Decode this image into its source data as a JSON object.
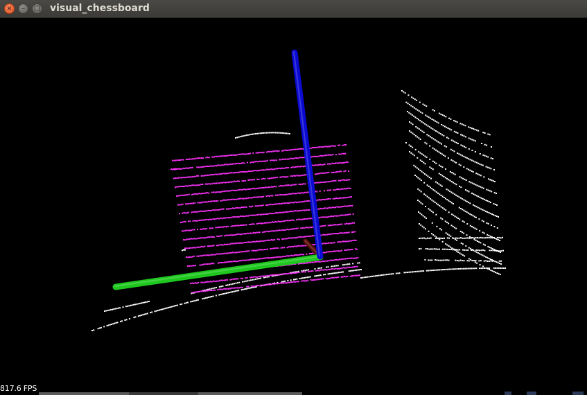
{
  "window": {
    "title": "visual_chessboard",
    "close_glyph": "×",
    "minimize_glyph": "–",
    "maximize_glyph": "□",
    "close_icon": "close-icon",
    "minimize_icon": "minimize-icon",
    "maximize_icon": "maximize-icon"
  },
  "viewport": {
    "fps_text": "817.6 FPS",
    "colors": {
      "background": "#000000",
      "chessboard_points": "#ff33ff",
      "scene_points": "#ffffff",
      "axis_x": "#1ec81e",
      "axis_z": "#0a0ad2",
      "axis_y": "#5a0f0a"
    }
  }
}
